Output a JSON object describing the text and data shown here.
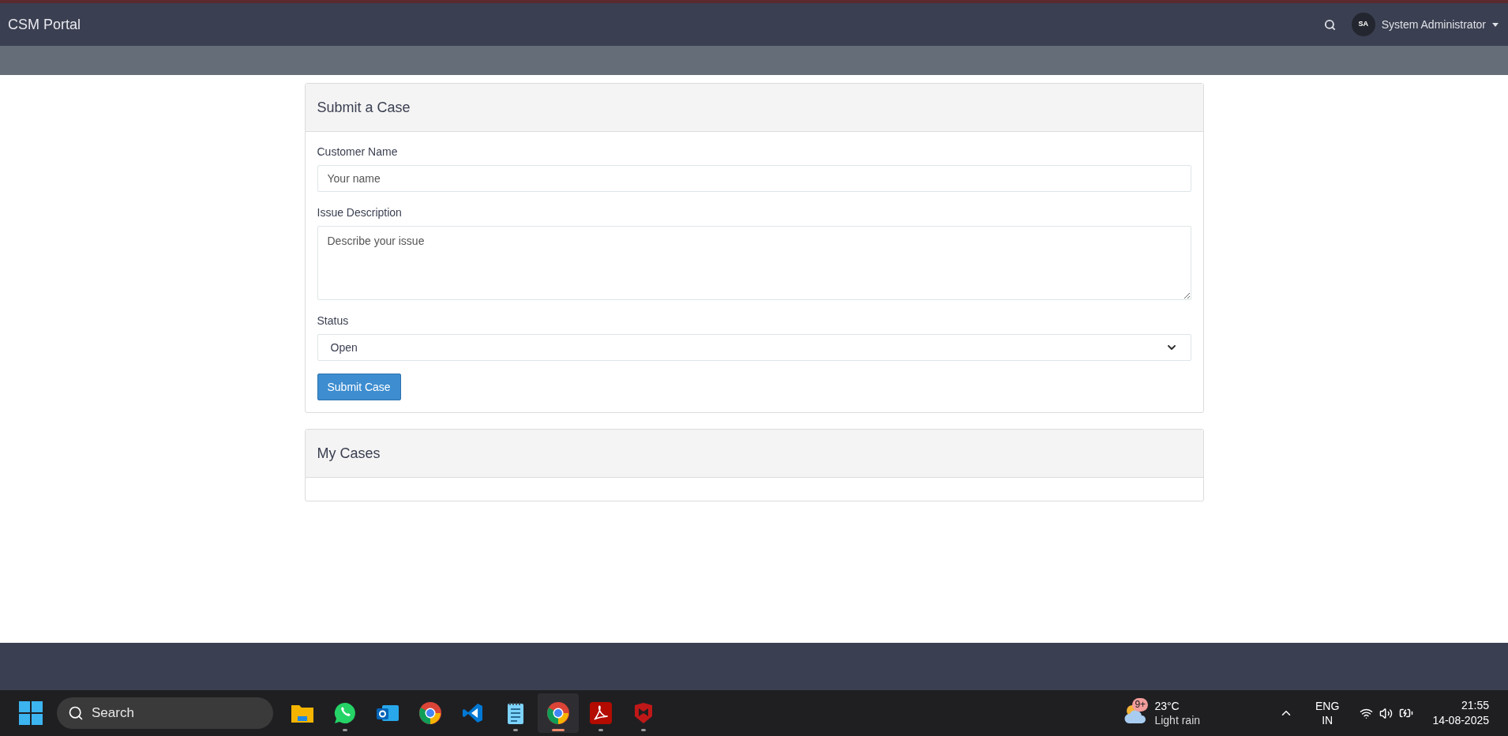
{
  "navbar": {
    "brand": "CSM Portal",
    "user": {
      "initials": "SA",
      "name": "System Administrator"
    }
  },
  "submit_card": {
    "title": "Submit a Case",
    "fields": [
      {
        "kind": "input",
        "label": "Customer Name",
        "placeholder": "Your name"
      },
      {
        "kind": "textarea",
        "label": "Issue Description",
        "placeholder": "Describe your issue"
      },
      {
        "kind": "select",
        "label": "Status",
        "value": "Open"
      }
    ],
    "button": "Submit Case"
  },
  "cases_card": {
    "title": "My Cases"
  },
  "taskbar": {
    "search": {
      "placeholder": "Search"
    },
    "apps": [
      {
        "kind": "files",
        "running": false,
        "selected": false
      },
      {
        "kind": "whatsapp",
        "running": true,
        "selected": false
      },
      {
        "kind": "outlook",
        "running": false,
        "selected": false
      },
      {
        "kind": "chrome",
        "running": false,
        "selected": false
      },
      {
        "kind": "vscode",
        "running": false,
        "selected": false
      },
      {
        "kind": "notepad",
        "running": true,
        "selected": false
      },
      {
        "kind": "chrome",
        "running": true,
        "selected": true
      },
      {
        "kind": "acrobat",
        "running": true,
        "selected": false
      },
      {
        "kind": "mcafee",
        "running": true,
        "selected": false
      }
    ],
    "weather": {
      "badge": "9+",
      "temp": "23°C",
      "condition": "Light rain"
    },
    "language": {
      "lang": "ENG",
      "region": "IN"
    },
    "clock": {
      "time": "21:55",
      "date": "14-08-2025"
    }
  }
}
